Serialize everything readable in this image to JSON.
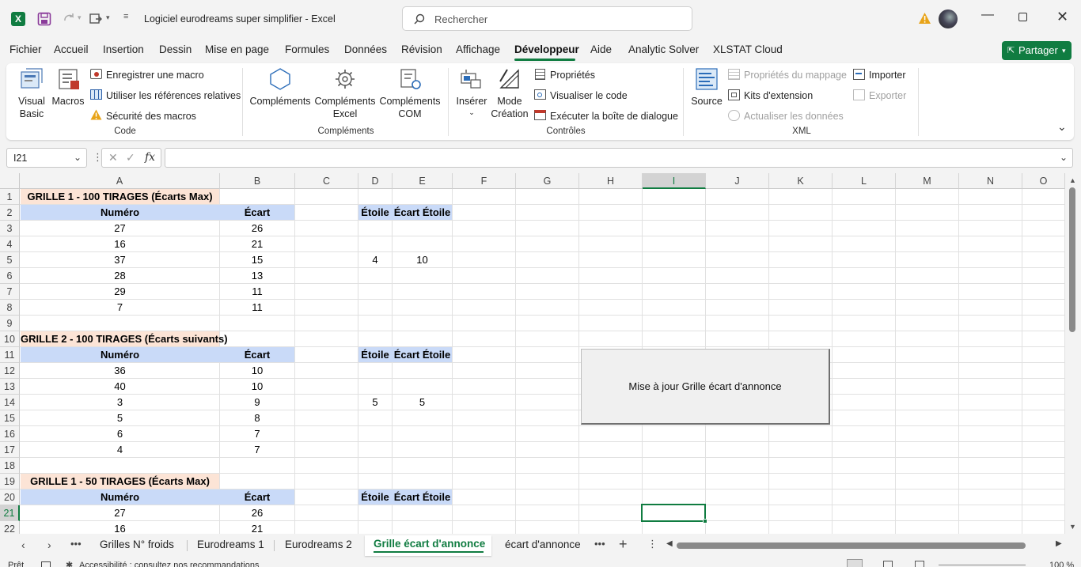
{
  "title_bar": {
    "doc_title": "Logiciel eurodreams super simplifier  -  Excel",
    "search_placeholder": "Rechercher"
  },
  "menu_tabs": [
    "Fichier",
    "Accueil",
    "Insertion",
    "Dessin",
    "Mise en page",
    "Formules",
    "Données",
    "Révision",
    "Affichage",
    "Développeur",
    "Aide",
    "Analytic Solver",
    "XLSTAT Cloud"
  ],
  "active_tab": "Développeur",
  "share_label": "Partager",
  "ribbon": {
    "code": {
      "group_label": "Code",
      "visual_basic": [
        "Visual",
        "Basic"
      ],
      "macros": "Macros",
      "record_macro": "Enregistrer une macro",
      "relative_refs": "Utiliser les références relatives",
      "macro_security": "Sécurité des macros"
    },
    "addins": {
      "group_label": "Compléments",
      "complements": "Compléments",
      "excel_complements": [
        "Compléments",
        "Excel"
      ],
      "com_complements": [
        "Compléments",
        "COM"
      ]
    },
    "controls": {
      "group_label": "Contrôles",
      "insert": "Insérer",
      "design_mode": [
        "Mode",
        "Création"
      ],
      "properties": "Propriétés",
      "view_code": "Visualiser le code",
      "run_dialog": "Exécuter la boîte de dialogue"
    },
    "xml": {
      "group_label": "XML",
      "source": "Source",
      "map_properties": "Propriétés du mappage",
      "expansion_packs": "Kits d'extension",
      "refresh_data": "Actualiser les données",
      "import": "Importer",
      "export": "Exporter"
    }
  },
  "formula_bar": {
    "name_box": "I21",
    "formula": ""
  },
  "columns": [
    "A",
    "B",
    "C",
    "D",
    "E",
    "F",
    "G",
    "H",
    "I",
    "J",
    "K",
    "L",
    "M",
    "N",
    "O"
  ],
  "selected_column": "I",
  "selected_row": "21",
  "rows": [
    "1",
    "2",
    "3",
    "4",
    "5",
    "6",
    "7",
    "8",
    "9",
    "10",
    "11",
    "12",
    "13",
    "14",
    "15",
    "16",
    "17",
    "18",
    "19",
    "20",
    "21",
    "22"
  ],
  "cells": {
    "r1_title": "GRILLE 1 - 100 TIRAGES (Écarts Max)",
    "r10_title": "GRILLE 2 - 100 TIRAGES (Écarts suivants)",
    "r19_title": "GRILLE 1 - 50 TIRAGES (Écarts Max)",
    "hdr_numero": "Numéro",
    "hdr_ecart": "Écart",
    "hdr_etoile": "Étoile",
    "hdr_ecart_etoile": "Écart Étoile",
    "block1": [
      [
        "27",
        "26"
      ],
      [
        "16",
        "21"
      ],
      [
        "37",
        "15"
      ],
      [
        "28",
        "13"
      ],
      [
        "29",
        "11"
      ],
      [
        "7",
        "11"
      ]
    ],
    "block2": [
      [
        "36",
        "10"
      ],
      [
        "40",
        "10"
      ],
      [
        "3",
        "9"
      ],
      [
        "5",
        "8"
      ],
      [
        "6",
        "7"
      ],
      [
        "4",
        "7"
      ]
    ],
    "block3": [
      [
        "27",
        "26"
      ],
      [
        "16",
        "21"
      ]
    ],
    "star1": [
      "4",
      "10"
    ],
    "star2": [
      "5",
      "5"
    ]
  },
  "macro_button": "Mise à jour Grille écart d'annonce",
  "sheet_tabs": [
    "Grilles N° froids",
    "Eurodreams 1",
    "Eurodreams 2",
    "Grille écart d'annonce",
    "écart d'annonce"
  ],
  "active_sheet": "Grille écart d'annonce",
  "status": {
    "ready": "Prêt",
    "accessibility": "Accessibilité : consultez nos recommandations",
    "zoom": "100 %"
  },
  "colors": {
    "excel_green": "#107c41",
    "title_fill": "#fce4d6",
    "header_fill": "#c9daf8",
    "selection": "#107c41"
  }
}
